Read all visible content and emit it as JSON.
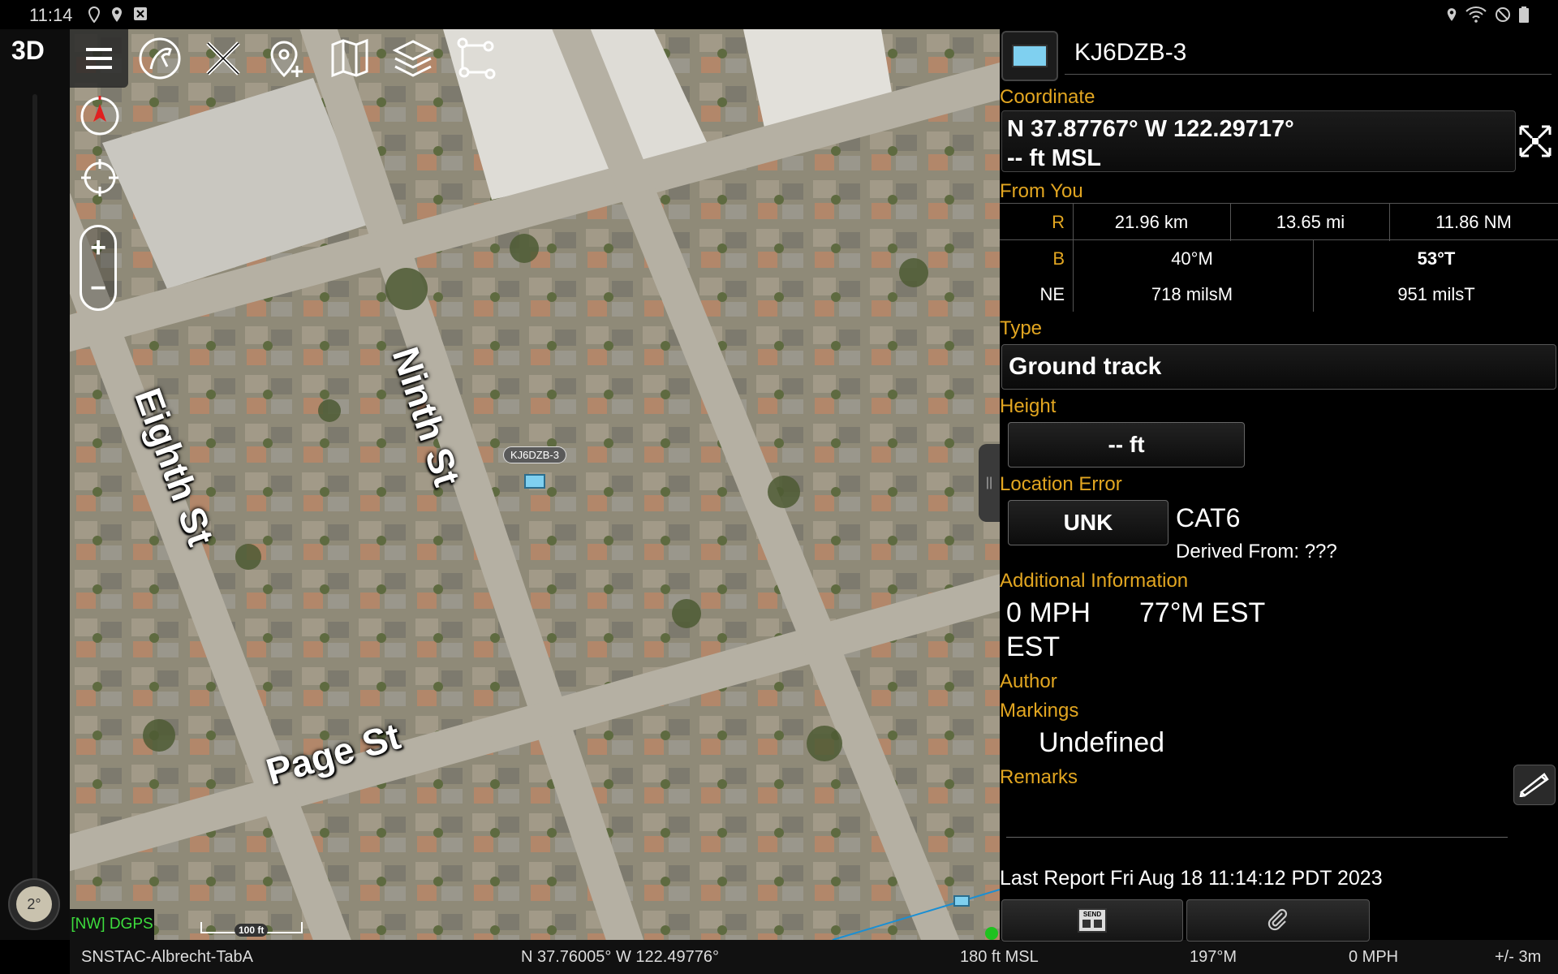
{
  "status_bar": {
    "time": "11:14"
  },
  "left_rail": {
    "mode": "3D",
    "tilt": "2°"
  },
  "map": {
    "streets": [
      "Ninth St",
      "Eighth St",
      "Page St"
    ],
    "marker_label": "KJ6DZB-3",
    "gps_status": "[NW] DGPS",
    "scale": "100 ft"
  },
  "bottom_bar": {
    "device": "SNSTAC-Albrecht-TabA",
    "self_coord": "N 37.76005°  W 122.49776°",
    "altitude": "180 ft MSL",
    "heading": "197°M",
    "speed": "0 MPH",
    "accuracy": "+/- 3m"
  },
  "panel": {
    "callsign": "KJ6DZB-3",
    "marker_color": "#7fd0f0",
    "coordinate_label": "Coordinate",
    "coordinate_line1": "N 37.87767°  W 122.29717°",
    "coordinate_line2": "-- ft MSL",
    "from_you_label": "From You",
    "range": {
      "label": "R",
      "km": "21.96 km",
      "mi": "13.65 mi",
      "nm": "11.86 NM"
    },
    "bearing": {
      "label": "B",
      "mag": "40°M",
      "true": "53°T"
    },
    "mils": {
      "label": "NE",
      "mag": "718 milsM",
      "true": "951 milsT"
    },
    "type_label": "Type",
    "type_value": "Ground track",
    "height_label": "Height",
    "height_value": "-- ft",
    "location_error_label": "Location Error",
    "location_error_value": "UNK",
    "category": "CAT6",
    "derived_from": "Derived From: ???",
    "additional_info_label": "Additional Information",
    "speed": "0 MPH",
    "course": "77°M EST",
    "est": "EST",
    "author_label": "Author",
    "markings_label": "Markings",
    "markings_value": "Undefined",
    "remarks_label": "Remarks",
    "last_report": "Last Report Fri Aug 18 11:14:12 PDT 2023",
    "send_label": "SEND"
  },
  "colors": {
    "accent": "#e2a621",
    "gps_ok": "#3ddc3d"
  }
}
